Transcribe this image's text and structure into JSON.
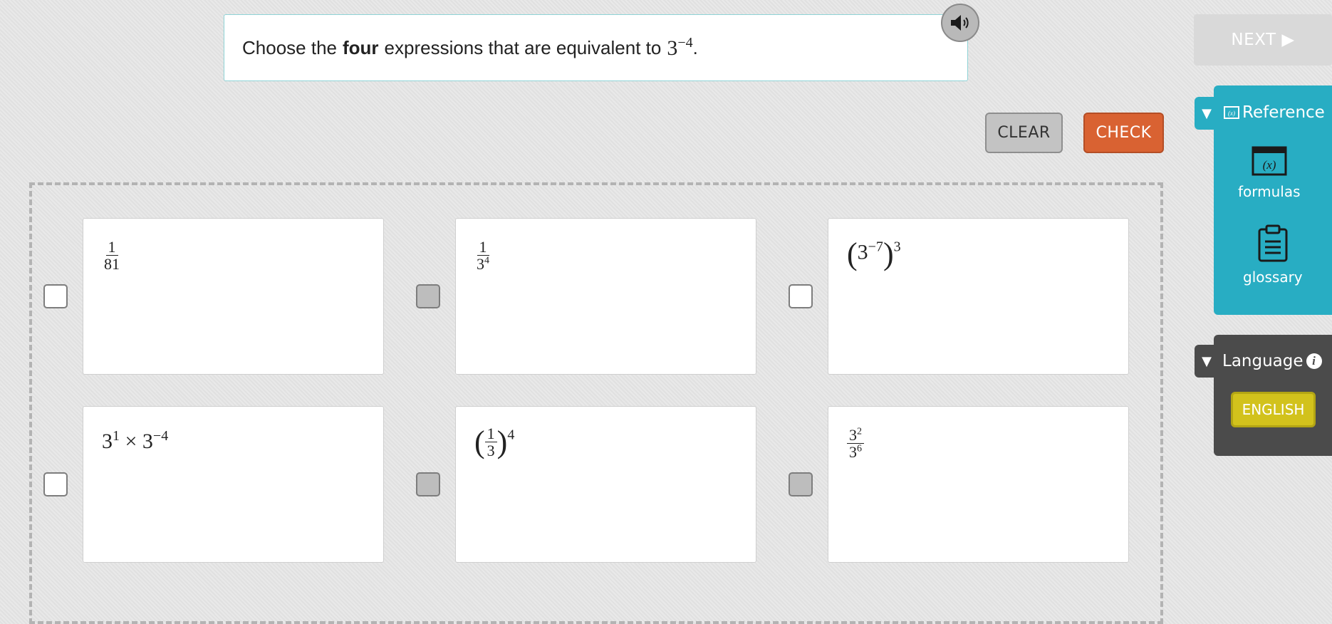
{
  "prompt": {
    "before": "Choose the",
    "bold": "four",
    "after": "expressions that are equivalent to",
    "math_base": "3",
    "math_exp": "−4",
    "period": "."
  },
  "toolbar": {
    "next_label": "NEXT ▶",
    "clear_label": "CLEAR",
    "check_label": "CHECK"
  },
  "options": [
    {
      "num": "1",
      "den": "81",
      "checked": false
    },
    {
      "num": "1",
      "den_base": "3",
      "den_exp": "4",
      "checked": true
    },
    {
      "base": "3",
      "inner_exp": "−7",
      "outer_exp": "3",
      "checked": false
    },
    {
      "a_base": "3",
      "a_exp": "1",
      "op": "×",
      "b_base": "3",
      "b_exp": "−4",
      "checked": false
    },
    {
      "num": "1",
      "den": "3",
      "outer_exp": "4",
      "checked": true
    },
    {
      "num_base": "3",
      "num_exp": "2",
      "den_base": "3",
      "den_exp": "6",
      "checked": true
    }
  ],
  "reference": {
    "title": "Reference",
    "formulas_label": "formulas",
    "formulas_icon_text": "(x)",
    "glossary_label": "glossary"
  },
  "language": {
    "title": "Language",
    "english_label": "ENGLISH"
  },
  "colors": {
    "accent_teal": "#28adc3",
    "check_orange": "#d96232",
    "english_yellow": "#d2c21c",
    "panel_dark": "#4b4b4b"
  }
}
